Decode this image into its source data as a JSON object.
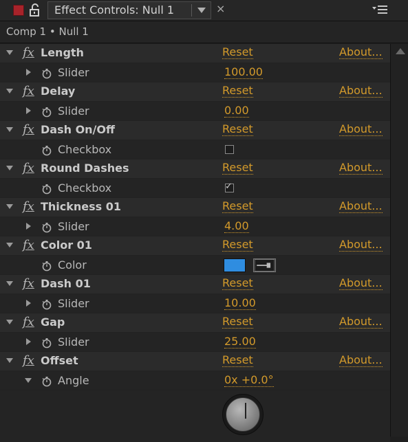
{
  "tab": {
    "title": "Effect Controls: Null 1",
    "close_glyph": "×"
  },
  "breadcrumb": {
    "text": "Comp 1 • Null 1"
  },
  "common": {
    "fx_label": "fx",
    "reset_label": "Reset",
    "about_label": "About..."
  },
  "effects": [
    {
      "name": "Length",
      "property": "Slider",
      "value": "100.00"
    },
    {
      "name": "Delay",
      "property": "Slider",
      "value": "0.00"
    },
    {
      "name": "Dash On/Off",
      "property": "Checkbox",
      "checked": false
    },
    {
      "name": "Round Dashes",
      "property": "Checkbox",
      "checked": true
    },
    {
      "name": "Thickness 01",
      "property": "Slider",
      "value": "4.00"
    },
    {
      "name": "Color 01",
      "property": "Color",
      "color": "#2f8de0"
    },
    {
      "name": "Dash 01",
      "property": "Slider",
      "value": "10.00"
    },
    {
      "name": "Gap",
      "property": "Slider",
      "value": "25.00"
    },
    {
      "name": "Offset",
      "property": "Angle",
      "value": "0x +0.0°"
    }
  ],
  "colors": {
    "accent": "#d39a2b",
    "panel_bg": "#1f1f1f",
    "swatch": "#2f8de0",
    "close_red": "#a8232a"
  },
  "icons": [
    "close-square-icon",
    "lock-icon",
    "dropdown-icon",
    "close-tab-icon",
    "panel-menu-icon",
    "twirl-icon",
    "stopwatch-icon",
    "eyedropper-icon",
    "angle-dial-icon",
    "scroll-up-icon"
  ]
}
